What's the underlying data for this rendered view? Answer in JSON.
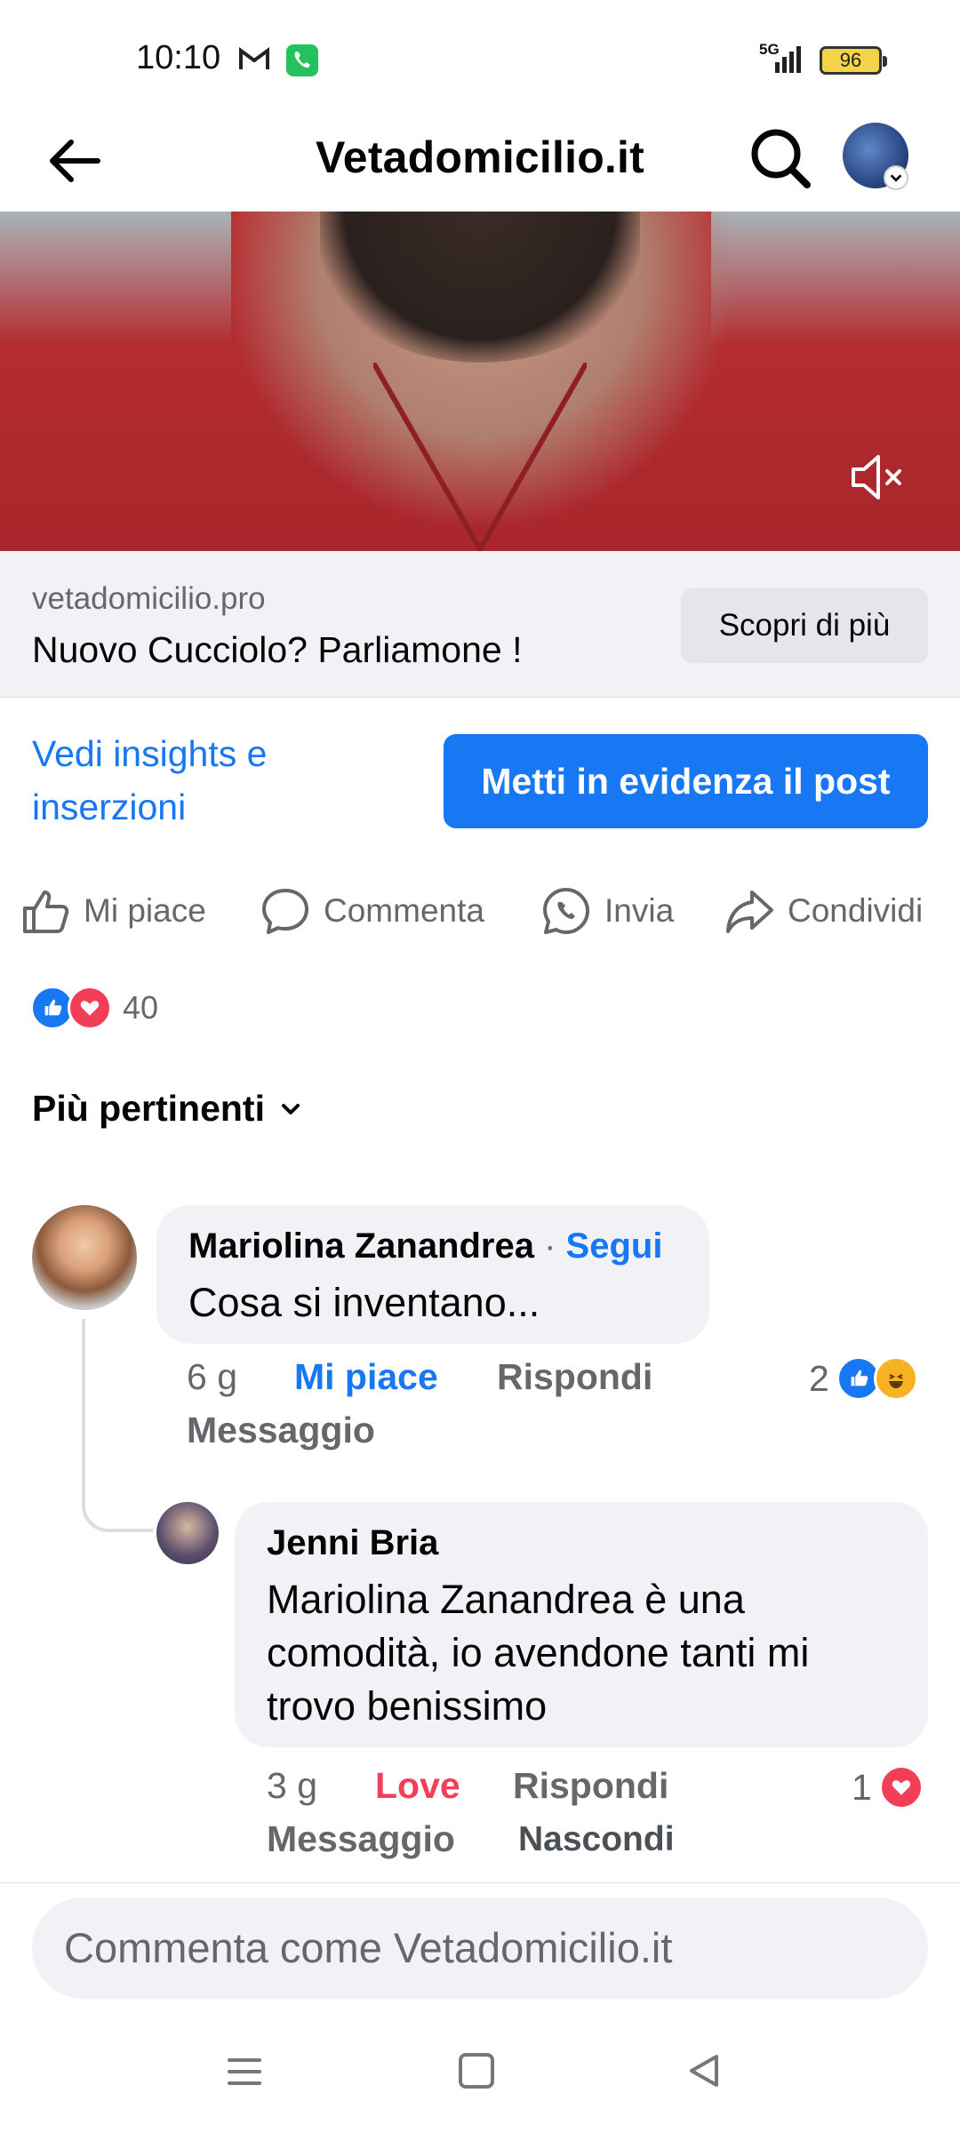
{
  "status_bar": {
    "time": "10:10",
    "network": "5G",
    "battery": "96"
  },
  "app_bar": {
    "title": "Vetadomicilio.it"
  },
  "link_card": {
    "domain": "vetadomicilio.pro",
    "title": "Nuovo Cucciolo? Parliamone !",
    "cta_label": "Scopri di più"
  },
  "insights": {
    "link_label": "Vedi insights e inserzioni",
    "boost_label": "Metti in evidenza il post"
  },
  "actions": {
    "like": "Mi piace",
    "comment": "Commenta",
    "send": "Invia",
    "share": "Condividi"
  },
  "reactions": {
    "count": "40"
  },
  "sort": {
    "label": "Più pertinenti"
  },
  "comments": [
    {
      "author": "Mariolina Zanandrea",
      "follow_label": "Segui",
      "text": "Cosa si inventano...",
      "time": "6 g",
      "reaction_label": "Mi piace",
      "reply_label": "Rispondi",
      "message_label": "Messaggio",
      "reaction_count": "2"
    },
    {
      "author": "Jenni Bria",
      "text": "Mariolina Zanandrea è una comodità, io avendone tanti mi trovo benissimo",
      "time": "3 g",
      "reaction_label": "Love",
      "reply_label": "Rispondi",
      "message_label": "Messaggio",
      "hide_label": "Nascondi",
      "reaction_count": "1"
    }
  ],
  "composer": {
    "placeholder": "Commenta come Vetadomicilio.it"
  },
  "colors": {
    "accent": "#1877f2",
    "love": "#f33e58",
    "bubble": "#f0f2f5",
    "muted": "#65676b"
  }
}
